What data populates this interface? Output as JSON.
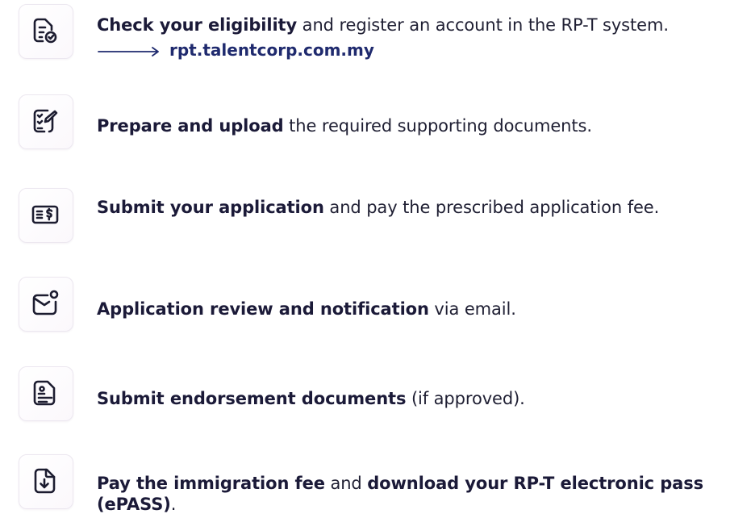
{
  "steps": [
    {
      "bold": "Check your eligibility",
      "rest": " and register an account in the RP-T system.",
      "link": "rpt.talentcorp.com.my",
      "icon": "document-check-icon"
    },
    {
      "bold": "Prepare and upload",
      "rest": " the required supporting documents.",
      "icon": "checklist-edit-icon"
    },
    {
      "bold": "Submit your application",
      "rest": " and pay the prescribed application fee.",
      "icon": "payment-icon"
    },
    {
      "bold": "Application review and notification",
      "rest": " via email.",
      "icon": "mail-notification-icon"
    },
    {
      "bold": "Submit endorsement documents",
      "rest": " (if approved).",
      "icon": "profile-document-icon"
    },
    {
      "bold": "Pay the immigration fee",
      "mid": " and ",
      "bold2": "download your RP-T electronic pass (ePASS)",
      "end": ".",
      "icon": "file-download-icon"
    }
  ]
}
